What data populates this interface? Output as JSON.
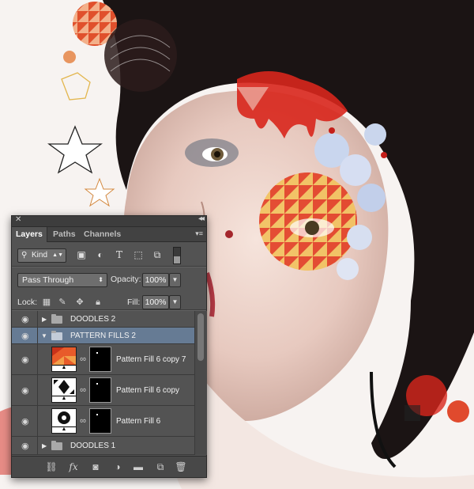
{
  "panel": {
    "close_glyph": "✕",
    "collapse_glyph": "◂◂",
    "menu_glyph": "▾≡",
    "tabs": [
      {
        "label": "Layers",
        "active": true
      },
      {
        "label": "Paths",
        "active": false
      },
      {
        "label": "Channels",
        "active": false
      }
    ],
    "filter": {
      "kind_label": "Kind",
      "icons": [
        "image-filter-icon",
        "adjustment-filter-icon",
        "type-filter-icon",
        "shape-filter-icon",
        "smart-object-filter-icon"
      ]
    },
    "blend": {
      "mode": "Pass Through",
      "opacity_label": "Opacity:",
      "opacity_value": "100%"
    },
    "lock": {
      "label": "Lock:",
      "fill_label": "Fill:",
      "fill_value": "100%",
      "icons": [
        "lock-transparent-icon",
        "lock-image-icon",
        "lock-position-icon",
        "lock-all-icon"
      ]
    },
    "layers": [
      {
        "name": "DOODLES 2",
        "type": "group",
        "expanded": false,
        "selected": false
      },
      {
        "name": "PATTERN FILLS 2",
        "type": "group",
        "expanded": true,
        "selected": true
      },
      {
        "name": "Pattern Fill 6 copy 7",
        "type": "pattern-fill",
        "selected": false
      },
      {
        "name": "Pattern Fill 6 copy",
        "type": "pattern-fill",
        "selected": false
      },
      {
        "name": "Pattern Fill 6",
        "type": "pattern-fill",
        "selected": false
      },
      {
        "name": "DOODLES 1",
        "type": "group",
        "expanded": false,
        "selected": false
      }
    ],
    "footer_icons": [
      "link-layers-icon",
      "fx-icon",
      "add-mask-icon",
      "adjustment-layer-icon",
      "new-group-icon",
      "new-layer-icon",
      "trash-icon"
    ]
  },
  "colors": {
    "panel_bg": "#535353",
    "selected_row": "#667b94",
    "accent_red": "#d8261c"
  }
}
